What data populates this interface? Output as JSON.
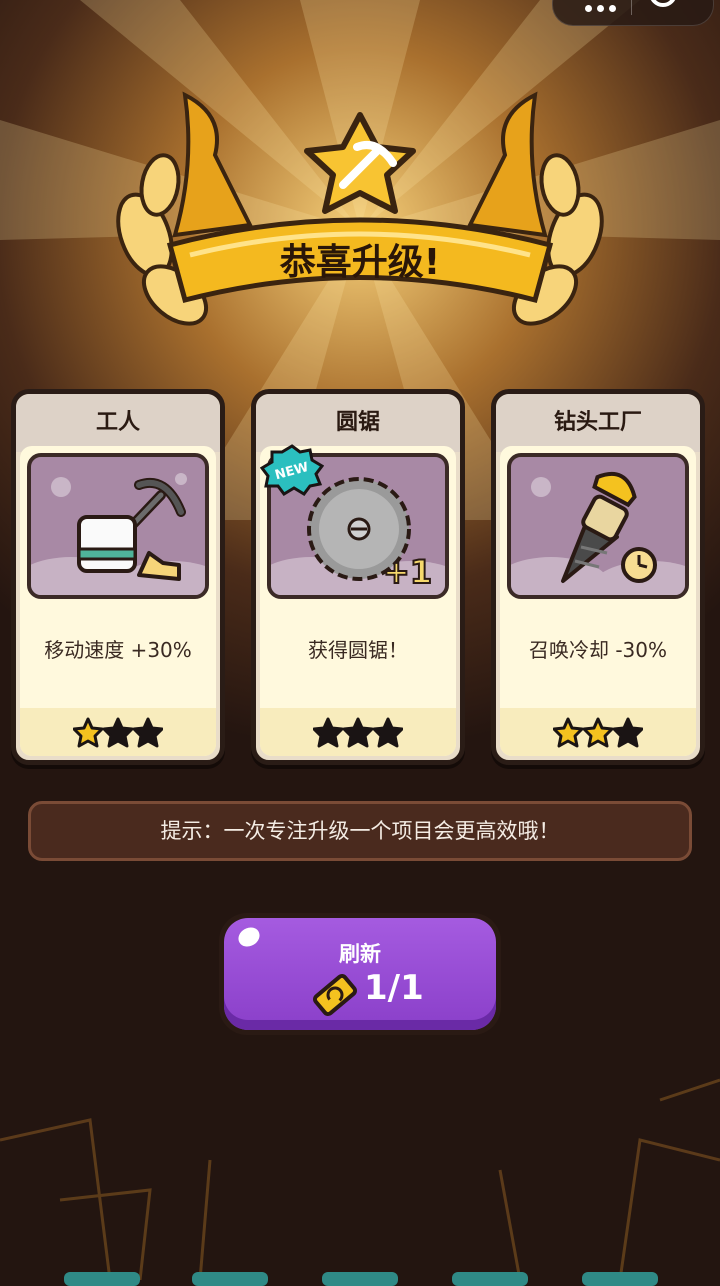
{
  "banner": {
    "title": "恭喜升级!",
    "icon": "pickaxe-star-icon"
  },
  "cards": [
    {
      "name": "工人",
      "icon": "worker-pickaxe-shoe-icon",
      "badge": "",
      "desc": "移动速度 +30%",
      "stars_filled": 1,
      "stars_total": 3
    },
    {
      "name": "圆锯",
      "icon": "circular-saw-icon",
      "badge": "NEW",
      "overlay": "+1",
      "desc": "获得圆锯！",
      "stars_filled": 0,
      "stars_total": 3
    },
    {
      "name": "钻头工厂",
      "icon": "drill-clock-icon",
      "badge": "",
      "desc": "召唤冷却 -30%",
      "stars_filled": 2,
      "stars_total": 3
    }
  ],
  "hint": "提示：一次专注升级一个项目会更高效哦！",
  "refresh": {
    "label": "刷新",
    "count": "1/1",
    "icon": "refresh-ticket-icon"
  },
  "colors": {
    "gold": "#f2b21c",
    "purple": "#9a4fd8",
    "star_filled": "#f4c21f",
    "star_empty": "#1a1414"
  }
}
